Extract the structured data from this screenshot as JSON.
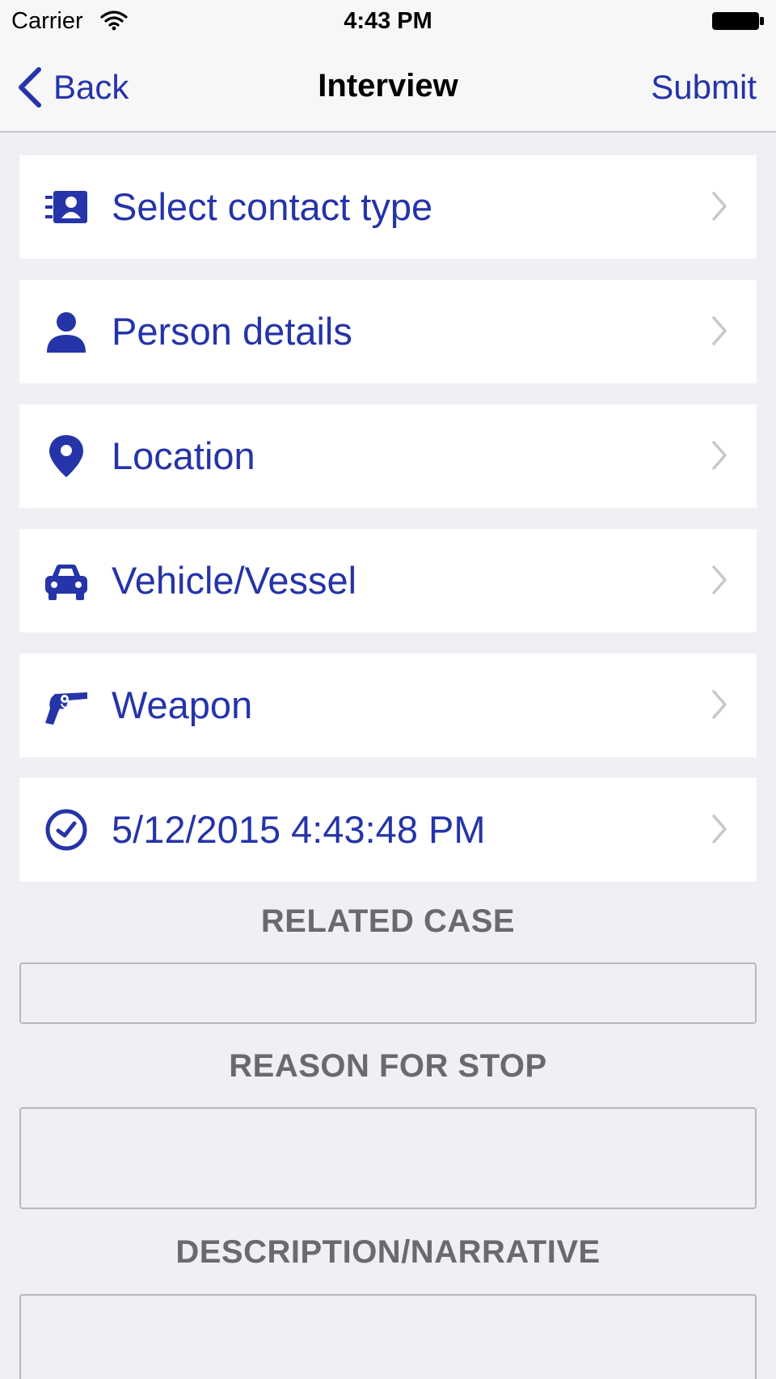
{
  "status_bar": {
    "carrier": "Carrier",
    "time": "4:43 PM"
  },
  "nav": {
    "back_label": "Back",
    "title": "Interview",
    "submit_label": "Submit"
  },
  "menu": [
    {
      "icon": "contact-card-icon",
      "label": "Select contact type"
    },
    {
      "icon": "person-icon",
      "label": "Person details"
    },
    {
      "icon": "location-pin-icon",
      "label": "Location"
    },
    {
      "icon": "car-icon",
      "label": "Vehicle/Vessel"
    },
    {
      "icon": "revolver-icon",
      "label": "Weapon"
    },
    {
      "icon": "clock-icon",
      "label": "5/12/2015 4:43:48 PM"
    }
  ],
  "sections": {
    "related_case": {
      "label": "RELATED CASE",
      "value": ""
    },
    "reason_for_stop": {
      "label": "REASON FOR STOP",
      "value": ""
    },
    "description": {
      "label": "DESCRIPTION/NARRATIVE",
      "value": ""
    }
  },
  "colors": {
    "accent": "#2534a8",
    "background": "#efeff4",
    "section_label": "#6a6a6e",
    "chevron": "#c7c7cc"
  }
}
